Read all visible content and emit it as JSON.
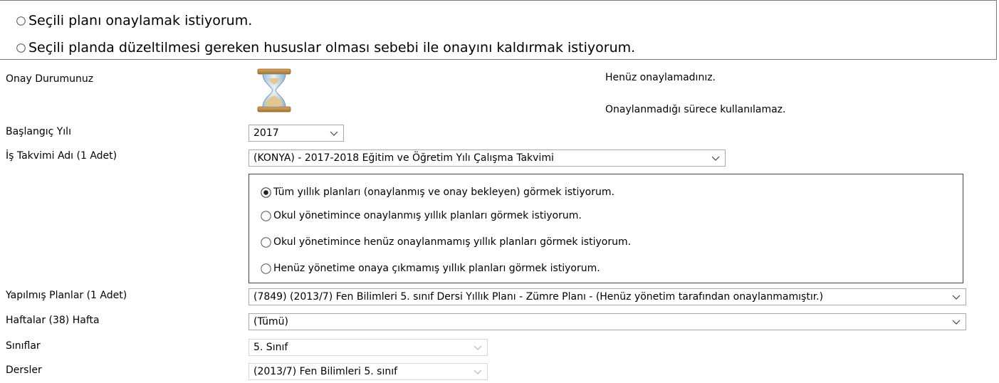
{
  "approval_options": [
    {
      "label": "Seçili planı onaylamak istiyorum.",
      "selected": false
    },
    {
      "label": "Seçili planda düzeltilmesi gereken hususlar olması sebebi ile onayını kaldırmak istiyorum.",
      "selected": false
    }
  ],
  "status": {
    "label": "Onay Durumunuz",
    "icon": "hourglass-icon",
    "line1": "Henüz onaylamadınız.",
    "line2": "Onaylanmadığı sürece kullanılamaz."
  },
  "start_year": {
    "label": "Başlangıç Yılı",
    "value": "2017"
  },
  "work_calendar": {
    "label": "İş Takvimi Adı (1 Adet)",
    "value": "(KONYA) - 2017-2018 Eğitim ve Öğretim Yılı Çalışma Takvimi"
  },
  "plan_filter": [
    {
      "label": "Tüm yıllık planları (onaylanmış ve onay bekleyen) görmek istiyorum.",
      "selected": true
    },
    {
      "label": "Okul yönetimince onaylanmış yıllık planları görmek istiyorum.",
      "selected": false
    },
    {
      "label": "Okul yönetimince henüz onaylanmamış yıllık planları görmek istiyorum.",
      "selected": false
    },
    {
      "label": "Henüz yönetime onaya çıkmamış yıllık planları görmek istiyorum.",
      "selected": false
    }
  ],
  "made_plans": {
    "label": "Yapılmış Planlar (1 Adet)",
    "value": "(7849) (2013/7) Fen Bilimleri 5. sınıf Dersi Yıllık Planı - Zümre Planı - (Henüz yönetim tarafından onaylanmamıştır.)"
  },
  "weeks": {
    "label": "Haftalar (38) Hafta",
    "value": "(Tümü)"
  },
  "classes": {
    "label": "Sınıflar",
    "value": "5. Sınıf"
  },
  "lessons": {
    "label": "Dersler",
    "value": "(2013/7) Fen Bilimleri 5. sınıf"
  }
}
